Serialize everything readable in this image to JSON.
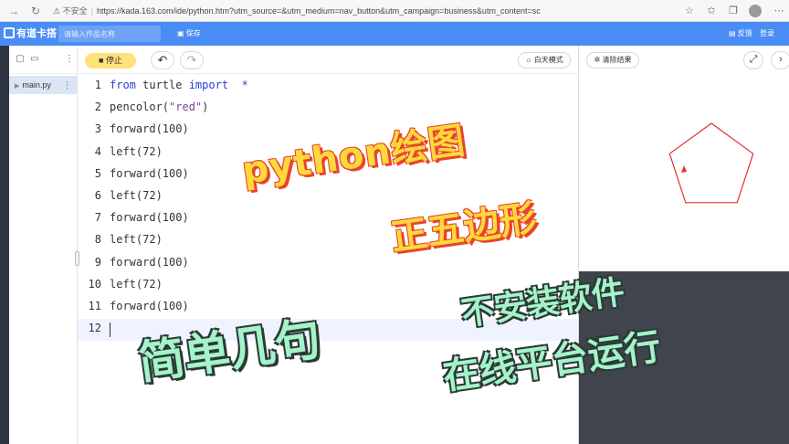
{
  "browser": {
    "security_label": "不安全",
    "url": "https://kada.163.com/ide/python.htm?utm_source=&utm_medium=nav_button&utm_campaign=business&utm_content=sc",
    "icons": [
      "back-icon",
      "reload-icon",
      "star-icon",
      "favorites-icon",
      "collections-icon",
      "profile-icon",
      "menu-icon"
    ]
  },
  "app_header": {
    "logo": "有道卡搭",
    "title_placeholder": "请输入作品名称",
    "save_label": "保存",
    "feedback_label": "反馈",
    "login_label": "登录"
  },
  "file_panel": {
    "files": [
      {
        "name": "main.py"
      }
    ]
  },
  "editor_toolbar": {
    "stop_label": "停止",
    "day_mode_label": "白天模式"
  },
  "code": {
    "lines": [
      {
        "n": "1",
        "parts": [
          {
            "t": "from",
            "c": "kw"
          },
          {
            "t": " turtle ",
            "c": ""
          },
          {
            "t": "import",
            "c": "kw"
          },
          {
            "t": "  *",
            "c": "kw"
          }
        ]
      },
      {
        "n": "2",
        "parts": [
          {
            "t": "pencolor(",
            "c": ""
          },
          {
            "t": "\"red\"",
            "c": "str"
          },
          {
            "t": ")",
            "c": ""
          }
        ]
      },
      {
        "n": "3",
        "parts": [
          {
            "t": "forward(100)",
            "c": ""
          }
        ]
      },
      {
        "n": "4",
        "parts": [
          {
            "t": "left(72)",
            "c": ""
          }
        ]
      },
      {
        "n": "5",
        "parts": [
          {
            "t": "forward(100)",
            "c": ""
          }
        ]
      },
      {
        "n": "6",
        "parts": [
          {
            "t": "left(72)",
            "c": ""
          }
        ]
      },
      {
        "n": "7",
        "parts": [
          {
            "t": "forward(100)",
            "c": ""
          }
        ]
      },
      {
        "n": "8",
        "parts": [
          {
            "t": "left(72)",
            "c": ""
          }
        ]
      },
      {
        "n": "9",
        "parts": [
          {
            "t": "forward(100)",
            "c": ""
          }
        ]
      },
      {
        "n": "10",
        "parts": [
          {
            "t": "left(72)",
            "c": ""
          }
        ]
      },
      {
        "n": "11",
        "parts": [
          {
            "t": "forward(100)",
            "c": ""
          }
        ]
      },
      {
        "n": "12",
        "parts": []
      }
    ]
  },
  "output_toolbar": {
    "clear_label": "清除结果"
  },
  "overlay": {
    "line1": "python绘图",
    "line2": "正五边形",
    "line3": "简单几句",
    "line4": "不安装软件",
    "line5": "在线平台运行"
  },
  "colors": {
    "header_blue": "#4a8cf5",
    "pen_red": "#e03030",
    "overlay_yellow": "#ffd83b",
    "overlay_green": "#a4f3c9",
    "stop_yellow": "#ffe27a"
  }
}
